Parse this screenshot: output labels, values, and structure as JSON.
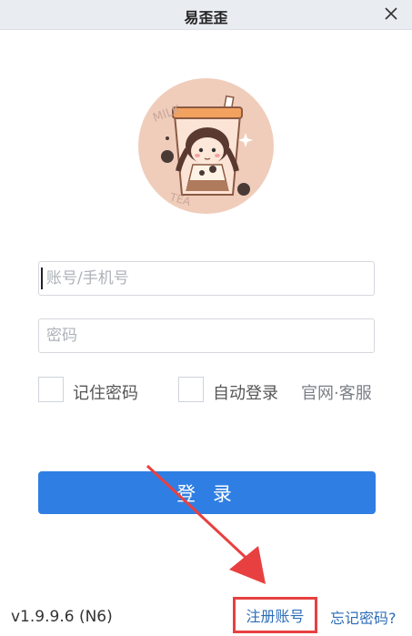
{
  "window": {
    "title": "易歪歪"
  },
  "avatar": {
    "text_lines": [
      "MILK",
      "TEA"
    ]
  },
  "form": {
    "account_placeholder": "账号/手机号",
    "password_placeholder": "密码"
  },
  "options": {
    "remember_label": "记住密码",
    "autologin_label": "自动登录",
    "service_link": "官网·客服"
  },
  "login_label": "登 录",
  "footer": {
    "version": "v1.9.9.6 (N6)",
    "register_label": "注册账号",
    "forgot_label": "忘记密码?"
  },
  "colors": {
    "accent": "#2f7ee3",
    "highlight": "#e84040",
    "link": "#2d6db8"
  }
}
